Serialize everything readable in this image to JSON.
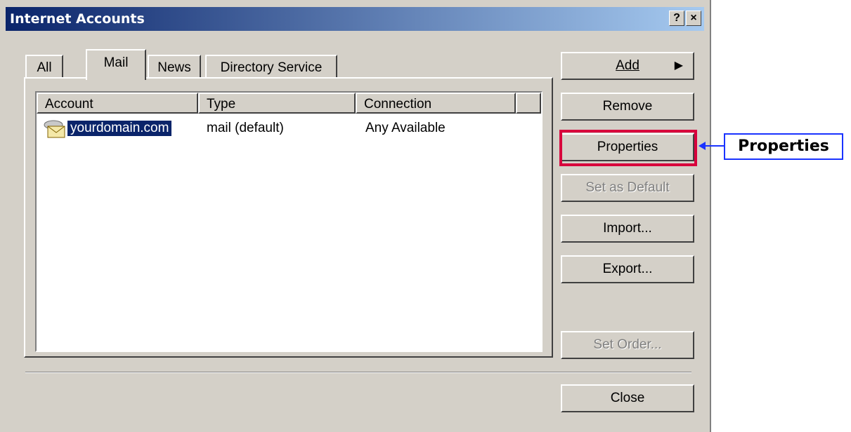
{
  "window": {
    "title": "Internet Accounts"
  },
  "titlebar_buttons": {
    "help": "?",
    "close": "×"
  },
  "tabs": [
    {
      "label": "All"
    },
    {
      "label": "Mail"
    },
    {
      "label": "News"
    },
    {
      "label": "Directory Service"
    }
  ],
  "list": {
    "columns": [
      "Account",
      "Type",
      "Connection"
    ],
    "rows": [
      {
        "account": "yourdomain.com",
        "type": "mail (default)",
        "connection": "Any Available"
      }
    ]
  },
  "buttons": {
    "add": "Add",
    "remove": "Remove",
    "properties": "Properties",
    "set_default": "Set as Default",
    "import": "Import...",
    "export": "Export...",
    "set_order": "Set Order...",
    "close": "Close"
  },
  "callout": {
    "label": "Properties"
  },
  "colors": {
    "highlight": "#d8003c",
    "callout_border": "#1a33ff",
    "selection": "#0a246a"
  }
}
